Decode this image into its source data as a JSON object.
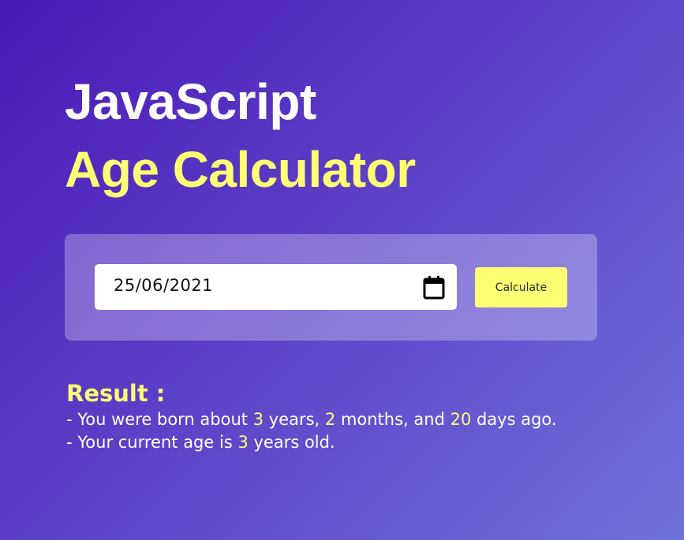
{
  "header": {
    "title_line1": "JavaScript",
    "title_line2": "Age Calculator"
  },
  "form": {
    "birth_date_value": "25/06/2021",
    "calendar_icon": "calendar-icon",
    "calculate_label": "Calculate"
  },
  "result": {
    "heading": "Result :",
    "line1": {
      "prefix": "- You were born about ",
      "years": "3",
      "years_label": " years, ",
      "months": "2",
      "months_label": " months, and ",
      "days": "20",
      "days_label": " days ago."
    },
    "line2": {
      "prefix": "- Your current age is ",
      "age": "3",
      "suffix": " years old."
    }
  },
  "colors": {
    "accent": "#ffff73",
    "background_start": "#4a19b8",
    "background_end": "#6f72dc"
  }
}
